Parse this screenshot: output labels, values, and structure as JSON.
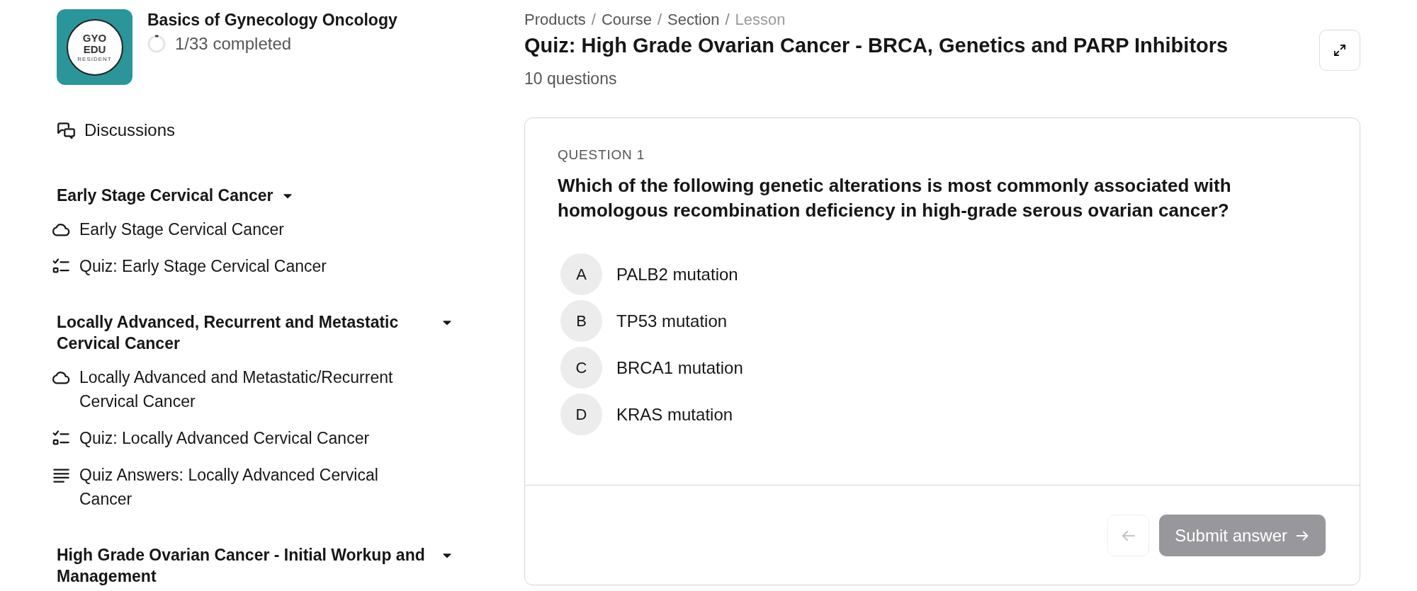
{
  "course": {
    "logo": {
      "lines": [
        "GYO",
        "EDU",
        "RESIDENT"
      ]
    },
    "title": "Basics of Gynecology Oncology",
    "progress": {
      "label": "1/33 completed"
    }
  },
  "sidebar": {
    "discussions": {
      "label": "Discussions"
    },
    "sections": [
      {
        "title": "Early Stage Cervical Cancer",
        "expanded": true,
        "items": [
          {
            "kind": "lesson",
            "label": "Early Stage Cervical Cancer"
          },
          {
            "kind": "quiz",
            "label": "Quiz: Early Stage Cervical Cancer"
          }
        ]
      },
      {
        "title": "Locally Advanced, Recurrent and Metastatic Cervical Cancer",
        "expanded": true,
        "items": [
          {
            "kind": "lesson",
            "label": "Locally Advanced and Metastatic/Recurrent Cervical Cancer"
          },
          {
            "kind": "quiz",
            "label": "Quiz: Locally Advanced Cervical Cancer"
          },
          {
            "kind": "text",
            "label": "Quiz Answers: Locally Advanced Cervical Cancer"
          }
        ]
      },
      {
        "title": "High Grade Ovarian Cancer - Initial Workup and Management",
        "expanded": true
      }
    ]
  },
  "header": {
    "breadcrumb": {
      "separator": "/",
      "items": [
        {
          "label": "Products",
          "current": false
        },
        {
          "label": "Course",
          "current": false
        },
        {
          "label": "Section",
          "current": false
        },
        {
          "label": "Lesson",
          "current": true
        }
      ]
    },
    "title": "Quiz: High Grade Ovarian Cancer - BRCA, Genetics and PARP Inhibitors",
    "subtitle": "10 questions"
  },
  "question": {
    "label": "QUESTION 1",
    "text": "Which of the following genetic alterations is most commonly associated with homologous recombination deficiency in high-grade serous ovarian cancer?",
    "options": [
      {
        "letter": "A",
        "text": "PALB2 mutation",
        "selected": false
      },
      {
        "letter": "B",
        "text": "TP53 mutation",
        "selected": false
      },
      {
        "letter": "C",
        "text": "BRCA1 mutation",
        "selected": false
      },
      {
        "letter": "D",
        "text": "KRAS mutation",
        "selected": false
      }
    ]
  },
  "footer": {
    "back": {
      "disabled": true
    },
    "submit": {
      "label": "Submit answer",
      "disabled": true
    }
  }
}
